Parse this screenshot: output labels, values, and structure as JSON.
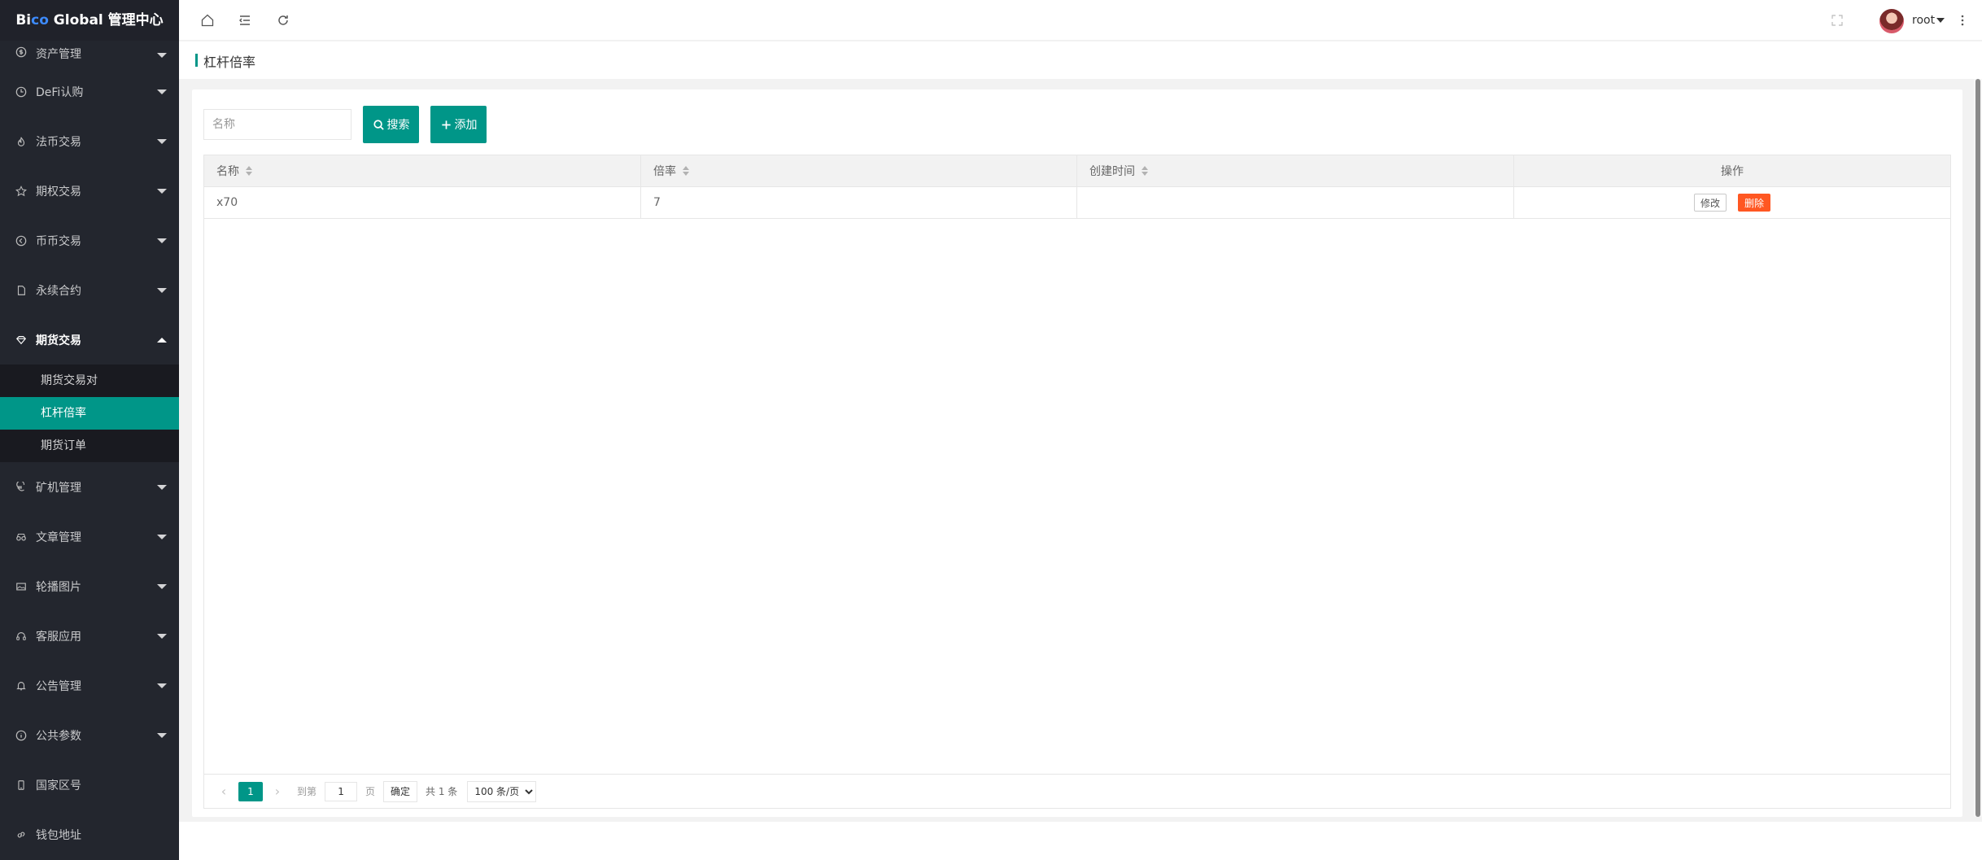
{
  "app": {
    "logo_prefix": "Bi",
    "logo_accent": "co",
    "logo_suffix": " Global 管理中心"
  },
  "sidebar": {
    "items": [
      {
        "label": "资产管理",
        "icon": "dollar-circle-icon"
      },
      {
        "label": "DeFi认购",
        "icon": "clock-icon"
      },
      {
        "label": "法币交易",
        "icon": "fire-icon"
      },
      {
        "label": "期权交易",
        "icon": "star-icon"
      },
      {
        "label": "币币交易",
        "icon": "circle-arrow-icon"
      },
      {
        "label": "永续合约",
        "icon": "file-icon"
      },
      {
        "label": "期货交易",
        "icon": "diamond-icon"
      },
      {
        "label": "矿机管理",
        "icon": "euro-icon"
      },
      {
        "label": "文章管理",
        "icon": "read-icon"
      },
      {
        "label": "轮播图片",
        "icon": "picture-icon"
      },
      {
        "label": "客服应用",
        "icon": "headset-icon"
      },
      {
        "label": "公告管理",
        "icon": "bell-icon"
      },
      {
        "label": "公共参数",
        "icon": "info-icon"
      },
      {
        "label": "国家区号",
        "icon": "phone-icon"
      },
      {
        "label": "钱包地址",
        "icon": "link-icon"
      }
    ],
    "submenu": [
      {
        "label": "期货交易对"
      },
      {
        "label": "杠杆倍率"
      },
      {
        "label": "期货订单"
      }
    ]
  },
  "header": {
    "username": "root"
  },
  "page": {
    "title": "杠杆倍率"
  },
  "toolbar": {
    "search_placeholder": "名称",
    "search_label": "搜索",
    "add_label": "添加"
  },
  "table": {
    "columns": [
      "名称",
      "倍率",
      "创建时间",
      "操作"
    ],
    "rows": [
      {
        "name": "x70",
        "rate": "7",
        "created": "",
        "edit_label": "修改",
        "delete_label": "删除"
      }
    ]
  },
  "pagination": {
    "current_page": "1",
    "goto_label": "到第",
    "goto_value": "1",
    "page_unit": "页",
    "confirm_label": "确定",
    "total_text": "共 1 条",
    "page_size": "100 条/页"
  },
  "colors": {
    "accent": "#009688",
    "danger": "#ff5722",
    "sidebar_bg": "#23262e"
  }
}
